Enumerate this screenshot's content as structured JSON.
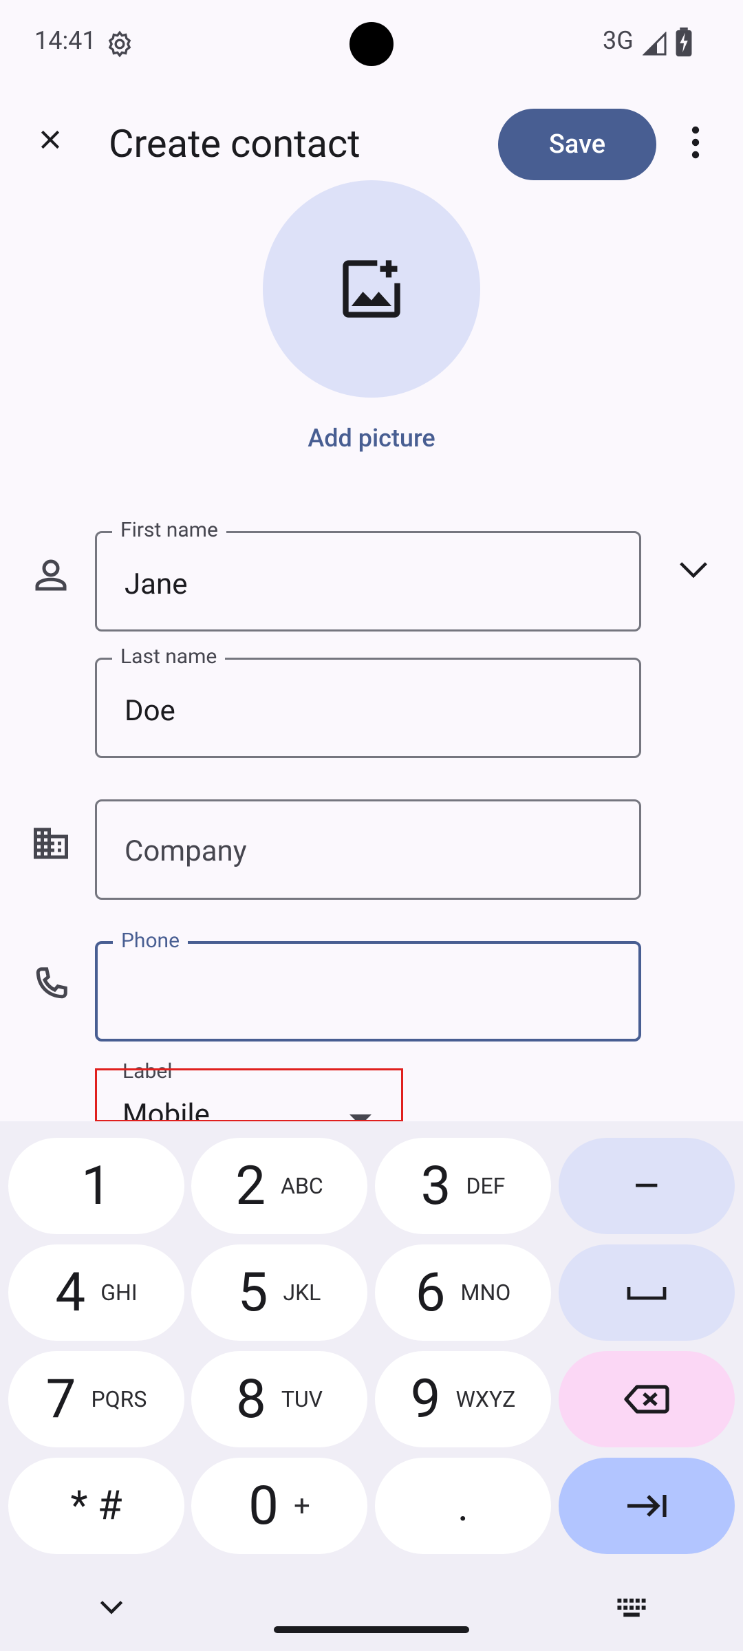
{
  "status_bar": {
    "time": "14:41",
    "network": "3G"
  },
  "app_bar": {
    "title": "Create contact",
    "save_label": "Save"
  },
  "avatar": {
    "add_picture_label": "Add picture"
  },
  "fields": {
    "first_name": {
      "label": "First name",
      "value": "Jane"
    },
    "last_name": {
      "label": "Last name",
      "value": "Doe"
    },
    "company": {
      "placeholder": "Company"
    },
    "phone": {
      "label": "Phone",
      "value": ""
    },
    "phone_label": {
      "label": "Label",
      "value": "Mobile"
    }
  },
  "keyboard": {
    "keys": [
      {
        "num": "1",
        "sub": ""
      },
      {
        "num": "2",
        "sub": "ABC"
      },
      {
        "num": "3",
        "sub": "DEF"
      },
      {
        "num": "4",
        "sub": "GHI"
      },
      {
        "num": "5",
        "sub": "JKL"
      },
      {
        "num": "6",
        "sub": "MNO"
      },
      {
        "num": "7",
        "sub": "PQRS"
      },
      {
        "num": "8",
        "sub": "TUV"
      },
      {
        "num": "9",
        "sub": "WXYZ"
      },
      {
        "num": "* #",
        "sub": ""
      },
      {
        "num": "0",
        "sub": "+"
      },
      {
        "num": ".",
        "sub": ""
      }
    ],
    "dash": "–"
  },
  "colors": {
    "accent": "#485e92",
    "avatar_bg": "#dde1f8",
    "keyboard_bg": "#f0eef6",
    "delete_key": "#fbd7f5",
    "enter_key": "#b2c5ff",
    "highlight": "#e0201e"
  }
}
